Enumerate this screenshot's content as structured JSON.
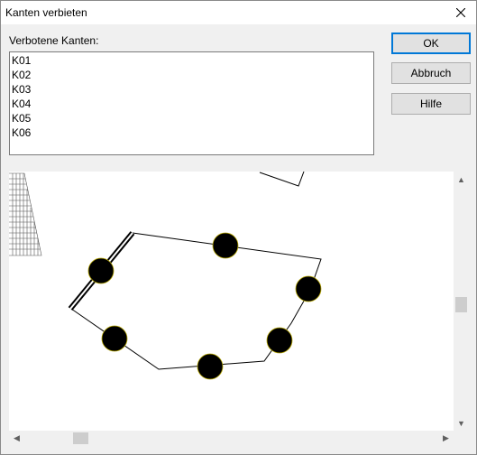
{
  "window": {
    "title": "Kanten verbieten"
  },
  "list": {
    "label": "Verbotene Kanten:",
    "items": [
      "K01",
      "K02",
      "K03",
      "K04",
      "K05",
      "K06"
    ]
  },
  "buttons": {
    "ok": "OK",
    "cancel": "Abbruch",
    "help": "Hilfe"
  },
  "colors": {
    "accent": "#0078d7",
    "node_fill": "#000000",
    "node_outline": "#b8a800"
  },
  "icons": {
    "close": "close-icon",
    "scroll_up": "arrow-up-icon",
    "scroll_down": "arrow-down-icon",
    "scroll_left": "arrow-left-icon",
    "scroll_right": "arrow-right-icon"
  }
}
